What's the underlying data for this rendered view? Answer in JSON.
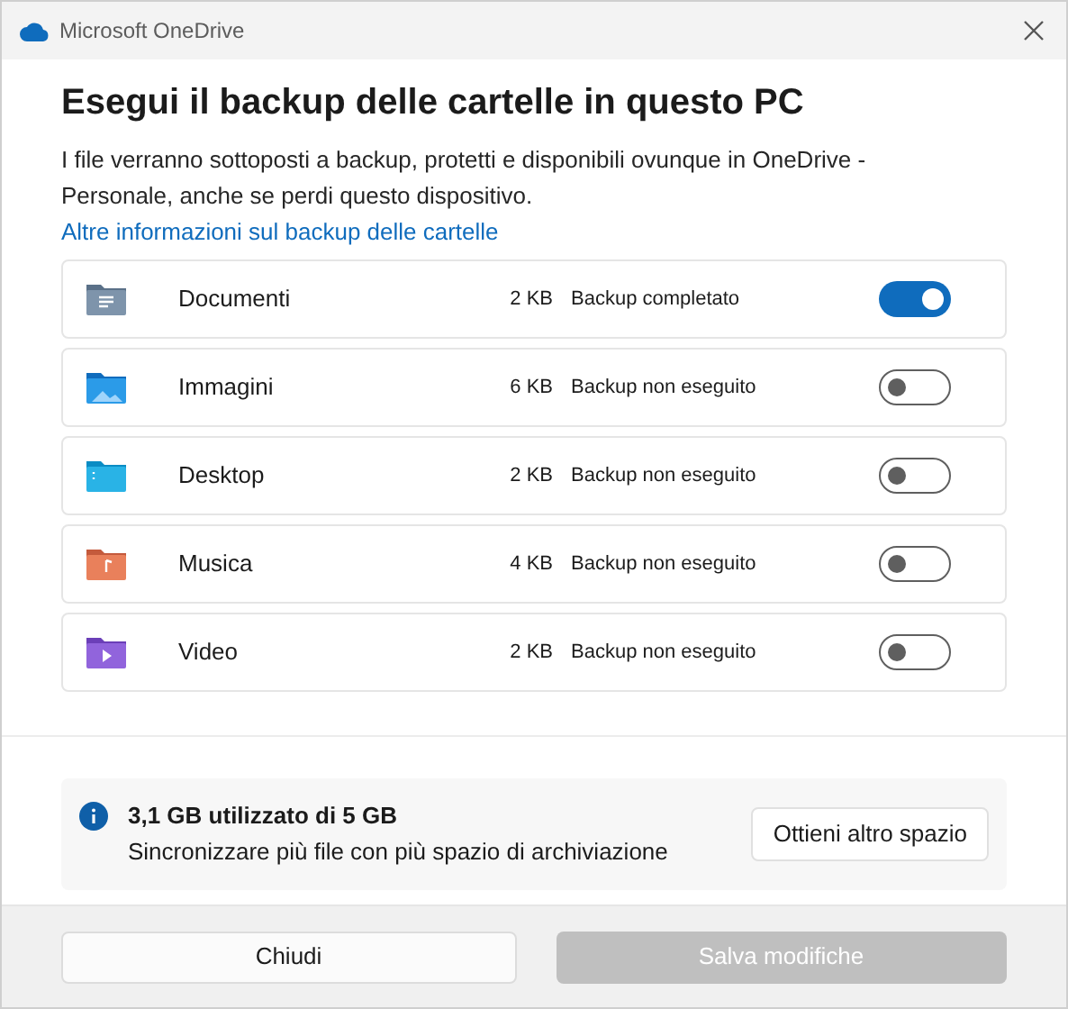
{
  "window": {
    "title": "Microsoft OneDrive"
  },
  "heading": "Esegui il backup delle cartelle in questo PC",
  "description": "I file verranno sottoposti a backup, protetti e disponibili ovunque in OneDrive - Personale, anche se perdi questo dispositivo.",
  "link": "Altre informazioni sul backup delle cartelle",
  "folders": [
    {
      "kind": "documents",
      "name": "Documenti",
      "size": "2 KB",
      "status": "Backup completato",
      "on": true
    },
    {
      "kind": "pictures",
      "name": "Immagini",
      "size": "6 KB",
      "status": "Backup non eseguito",
      "on": false
    },
    {
      "kind": "desktop",
      "name": "Desktop",
      "size": "2 KB",
      "status": "Backup non eseguito",
      "on": false
    },
    {
      "kind": "music",
      "name": "Musica",
      "size": "4 KB",
      "status": "Backup non eseguito",
      "on": false
    },
    {
      "kind": "video",
      "name": "Video",
      "size": "2 KB",
      "status": "Backup non eseguito",
      "on": false
    }
  ],
  "storage": {
    "title": "3,1 GB utilizzato di 5 GB",
    "subtitle": "Sincronizzare più file con più spazio di archiviazione",
    "button": "Ottieni altro spazio"
  },
  "buttons": [
    {
      "label": "Chiudi",
      "disabled": false
    },
    {
      "label": "Salva modifiche",
      "disabled": true
    }
  ]
}
